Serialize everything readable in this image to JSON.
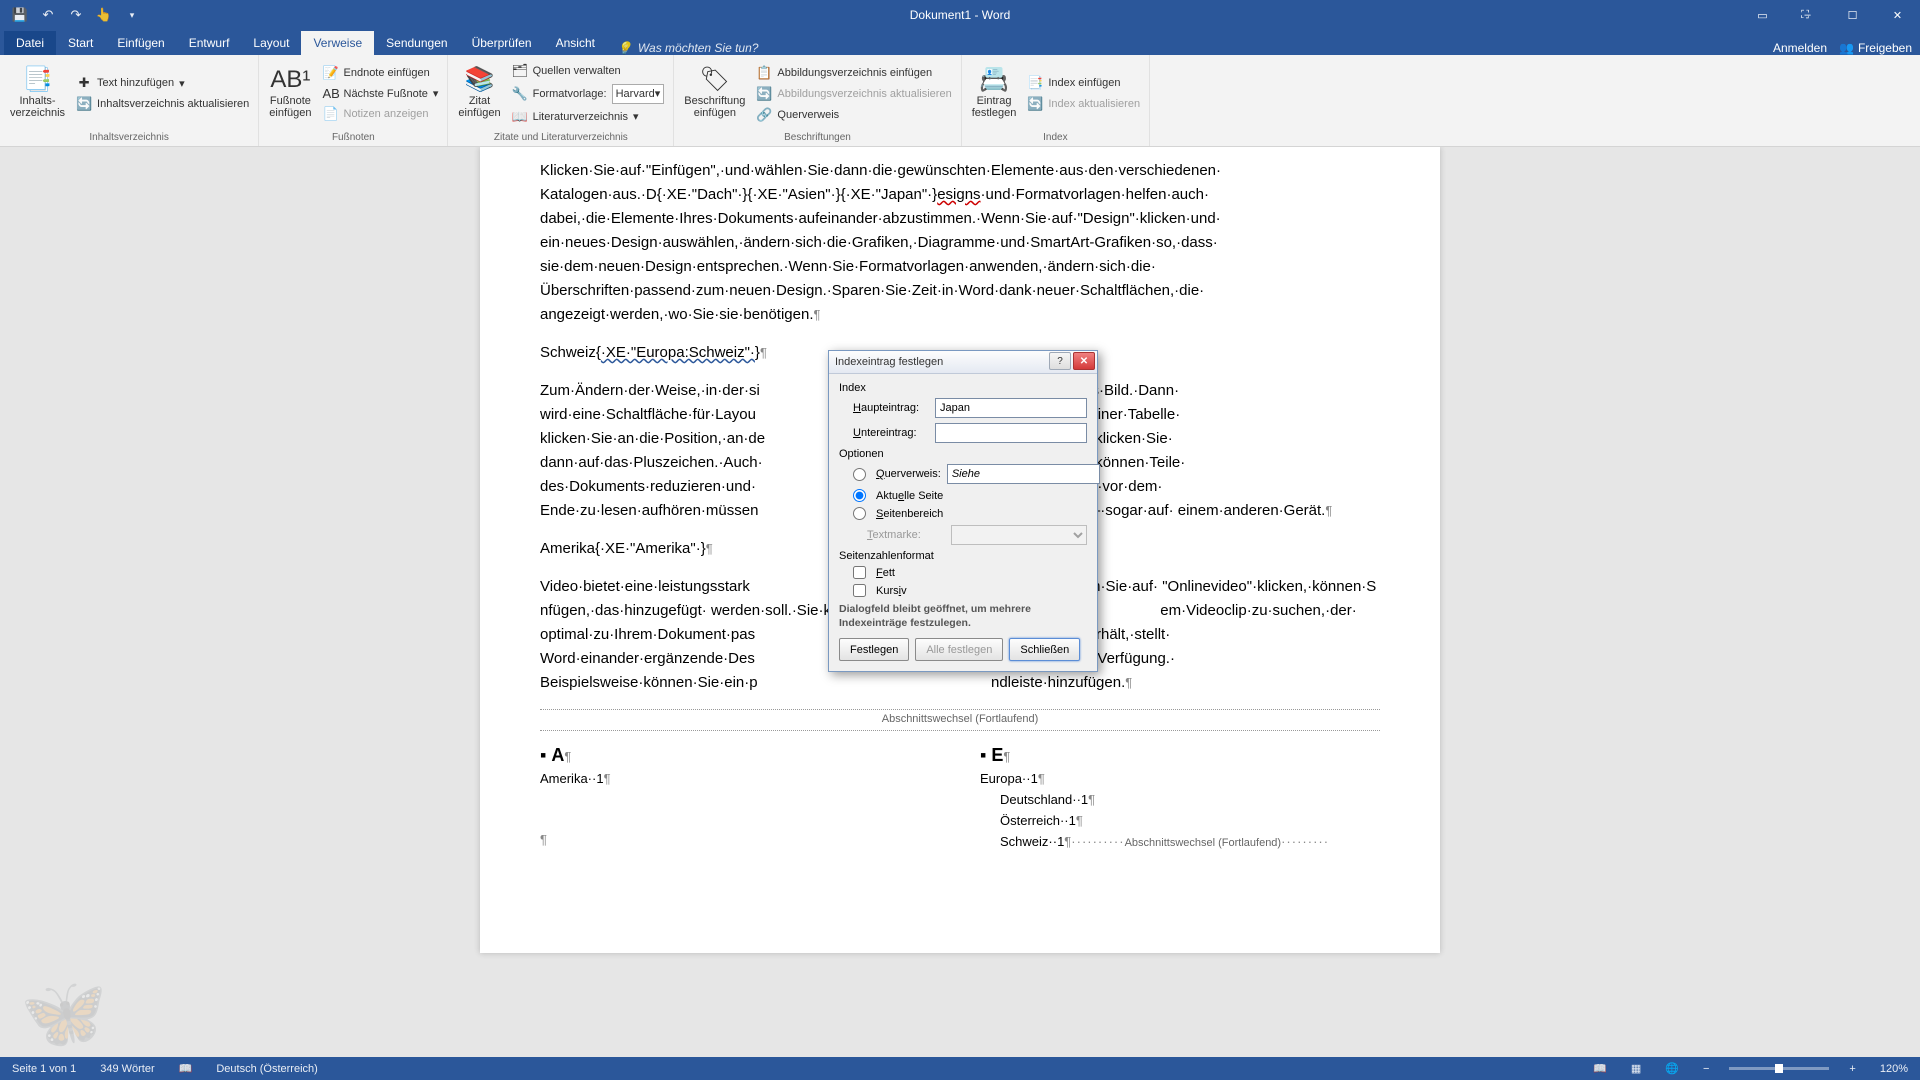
{
  "app": {
    "title": "Dokument1 - Word"
  },
  "qat": [
    "save-icon",
    "undo-icon",
    "redo-icon",
    "touch-icon"
  ],
  "win": {
    "min": "–",
    "max": "☐",
    "close": "✕",
    "ribbonOpt": "▭",
    "fullscreen": "⛶"
  },
  "tabs": {
    "file": "Datei",
    "items": [
      "Start",
      "Einfügen",
      "Entwurf",
      "Layout",
      "Verweise",
      "Sendungen",
      "Überprüfen",
      "Ansicht"
    ],
    "active": "Verweise",
    "tellme_icon": "💡",
    "tellme": "Was möchten Sie tun?",
    "signin": "Anmelden",
    "share": "Freigeben"
  },
  "ribbon": {
    "g1": {
      "label": "Inhaltsverzeichnis",
      "big": "Inhalts-\nverzeichnis",
      "s1": "Text hinzufügen",
      "s2": "Inhaltsverzeichnis aktualisieren"
    },
    "g2": {
      "label": "Fußnoten",
      "big": "Fußnote\neinfügen",
      "s1": "Endnote einfügen",
      "s2": "Nächste Fußnote",
      "s3": "Notizen anzeigen"
    },
    "g3": {
      "label": "Zitate und Literaturverzeichnis",
      "big": "Zitat\neinfügen",
      "s1": "Quellen verwalten",
      "s2": "Formatvorlage:",
      "combo": "Harvard",
      "s3": "Literaturverzeichnis"
    },
    "g4": {
      "label": "Beschriftungen",
      "big": "Beschriftung\neinfügen",
      "s1": "Abbildungsverzeichnis einfügen",
      "s2": "Abbildungsverzeichnis aktualisieren",
      "s3": "Querverweis"
    },
    "g5": {
      "label": "Index",
      "big": "Eintrag\nfestlegen",
      "s1": "Index einfügen",
      "s2": "Index aktualisieren"
    }
  },
  "doc": {
    "para1_a": "Klicken·Sie·auf·\"Einfügen\",·und·wählen·Sie·dann·die·gewünschten·Elemente·aus·den·verschiedenen· Katalogen·aus.·D",
    "xe1": "·XE·\"Dach\"·",
    "xe2": "·XE·\"Asien\"·",
    "xe3": "·XE·\"Japan\"·",
    "para1_b": "esigns",
    "para1_c": "·und·Formatvorlagen·helfen·auch· dabei,·die·Elemente·Ihres·Dokuments·aufeinander·abzustimmen.·Wenn·Sie·auf·\"Design\"·klicken·und· ein·neues·Design·auswählen,·ändern·sich·die·Grafiken,·Diagramme·und·SmartArt-Grafiken·so,·dass· sie·dem·neuen·Design·entsprechen.·Wenn·Sie·Formatvorlagen·anwenden,·ändern·sich·die· Überschriften·passend·zum·neuen·Design.·Sparen·Sie·Zeit·in·Word·dank·neuer·Schaltflächen,·die· angezeigt·werden,·wo·Sie·sie·benötigen.",
    "para2_a": "Schweiz",
    "xe4": "·XE·\"Europa:Schweiz\"·",
    "para3": "Zum·Ändern·der·Weise,·in·der·si                                                        ken·Sie·auf·das·Bild.·Dann· wird·eine·Schaltfläche·für·Layou                                                        m·Arbeiten·an·einer·Tabelle· klicken·Sie·an·die·Position,·an·de                                                        möchten,·und·klicken·Sie· dann·auf·das·Pluszeichen.·Auch·                                                        seansicht.·Sie·können·Teile· des·Dokuments·reduzieren·und·                                                        ieren.·Wenn·Sie·vor·dem· Ende·zu·lesen·aufhören·müssen                                                        e·gelangt·sind·–·sogar·auf· einem·anderen·Gerät.",
    "para4_a": "Amerika",
    "xe5": "·XE·\"Amerika\"·",
    "para5": "Video·bietet·eine·leistungsstark                                                        andpunkts.·Wenn·Sie·auf· \"Onlinevideo\"·klicken,·können·S                                                        nfügen,·das·hinzugefügt· werden·soll.·Sie·können·auch·ei                                                        em·Videoclip·zu·suchen,·der· optimal·zu·Ihrem·Dokument·pas                                                        lles·Aussehen·erhält,·stellt· Word·einander·ergänzende·Des                                                        d-Textfelder·zur·Verfügung.· Beispielsweise·können·Sie·ein·p                                                        ndleiste·hinzufügen.",
    "secbreak": "Abschnittswechsel (Fortlaufend)",
    "idx": {
      "A": "A",
      "amerika": "Amerika··1",
      "E": "E",
      "europa": "Europa··1",
      "de": "Deutschland··1",
      "at": "Österreich··1",
      "ch": "Schweiz··1",
      "secbreak2": "Abschnittswechsel (Fortlaufend)"
    }
  },
  "dialog": {
    "title": "Indexeintrag festlegen",
    "section_index": "Index",
    "lbl_main": "Haupteintrag:",
    "val_main": "Japan",
    "lbl_sub": "Untereintrag:",
    "val_sub": "",
    "section_opts": "Optionen",
    "opt_xref": "Querverweis:",
    "val_xref": "Siehe",
    "opt_curr": "Aktuelle Seite",
    "opt_range": "Seitenbereich",
    "lbl_bookmark": "Textmarke:",
    "section_fmt": "Seitenzahlenformat",
    "chk_bold": "Fett",
    "chk_italic": "Kursiv",
    "note": "Dialogfeld bleibt geöffnet, um mehrere Indexeinträge festzulegen.",
    "btn_mark": "Festlegen",
    "btn_all": "Alle festlegen",
    "btn_close": "Schließen"
  },
  "status": {
    "page": "Seite 1 von 1",
    "words": "349 Wörter",
    "lang": "Deutsch (Österreich)",
    "zoom": "120%"
  }
}
